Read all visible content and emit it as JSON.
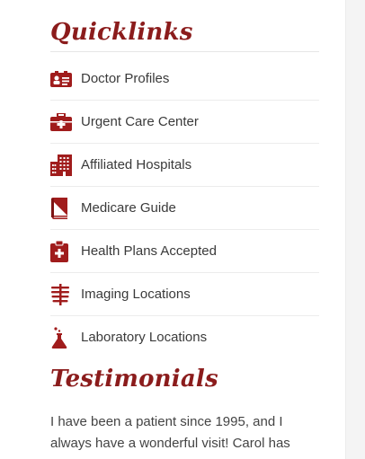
{
  "quicklinks": {
    "title": "Quicklinks",
    "accent": "#a01c1c",
    "items": [
      {
        "label": "Doctor Profiles",
        "icon": "id-card-icon"
      },
      {
        "label": "Urgent Care Center",
        "icon": "medical-kit-icon"
      },
      {
        "label": "Affiliated Hospitals",
        "icon": "hospital-building-icon"
      },
      {
        "label": "Medicare Guide",
        "icon": "book-icon"
      },
      {
        "label": "Health Plans Accepted",
        "icon": "clipboard-plus-icon"
      },
      {
        "label": "Imaging Locations",
        "icon": "ribcage-xray-icon"
      },
      {
        "label": "Laboratory Locations",
        "icon": "flask-icon"
      }
    ]
  },
  "testimonials": {
    "title": "Testimonials",
    "text": "I have been a patient since 1995, and I always have a wonderful visit! Carol has"
  }
}
